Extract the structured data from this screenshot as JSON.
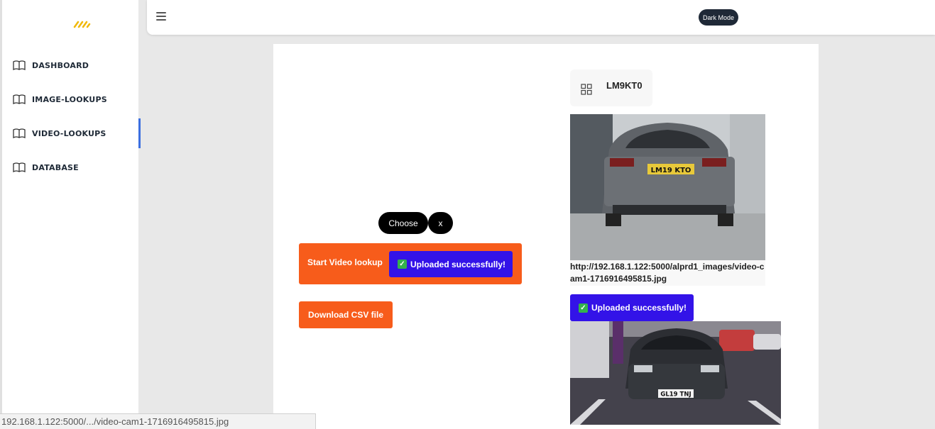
{
  "sidebar": {
    "items": [
      {
        "label": "DASHBOARD"
      },
      {
        "label": "IMAGE-LOOKUPS"
      },
      {
        "label": "VIDEO-LOOKUPS"
      },
      {
        "label": "DATABASE"
      }
    ],
    "active_index": 2
  },
  "topbar": {
    "dark_mode_label": "Dark Mode"
  },
  "upload": {
    "choose_label": "Choose",
    "clear_label": "x",
    "start_label": "Start Video lookup",
    "status_message": "Uploaded successfully!",
    "csv_label": "Download CSV file"
  },
  "result": {
    "plate": "LM9KT0",
    "image_1_plate_text": "LM19 KTO",
    "image_url": "http://192.168.1.122:5000/alprd1_images/video-cam1-1716916495815.jpg",
    "status_message": "Uploaded successfully!",
    "image_2_plate_text": "GL19 TNJ"
  },
  "statusbar": {
    "text": "192.168.1.122:5000/.../video-cam1-1716916495815.jpg"
  },
  "colors": {
    "accent_orange": "#f75c1b",
    "badge_blue": "#3313e8",
    "active_nav": "#3b6fe0",
    "logo_yellow": "#f0b90b"
  }
}
